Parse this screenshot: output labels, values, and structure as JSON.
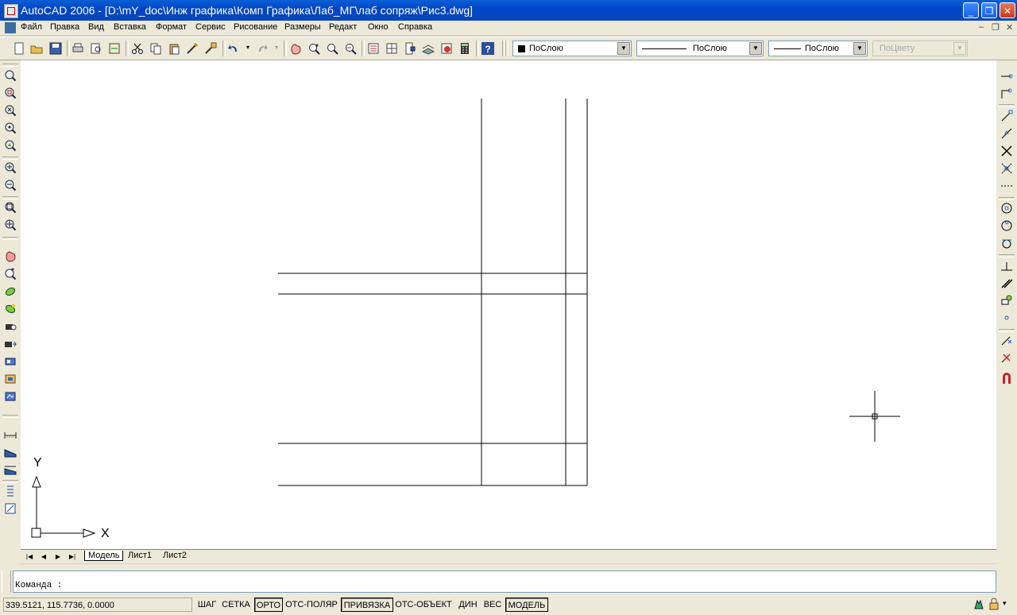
{
  "window": {
    "title": "AutoCAD 2006 - [D:\\mY_doc\\Инж графика\\Комп Графика\\Лаб_МГ\\лаб сопряж\\Рис3.dwg]"
  },
  "menu": {
    "items": [
      "Файл",
      "Правка",
      "Вид",
      "Вставка",
      "Формат",
      "Сервис",
      "Рисование",
      "Размеры",
      "Редакт",
      "Окно",
      "Справка"
    ]
  },
  "properties": {
    "color": "ПоСлою",
    "linetype": "ПоСлою",
    "lineweight": "ПоСлою",
    "plotstyle": "ПоЦвету"
  },
  "ucs": {
    "y_label": "Y",
    "x_label": "X"
  },
  "tabs": [
    "Модель",
    "Лист1",
    "Лист2"
  ],
  "active_tab": "Модель",
  "command": {
    "prompt": "Команда :"
  },
  "status": {
    "coords": "339.5121, 115.7736, 0.0000",
    "buttons": [
      "ШАГ",
      "СЕТКА",
      "ОРТО",
      "ОТС-ПОЛЯР",
      "ПРИВЯЗКА",
      "ОТС-ОБЪЕКТ",
      "ДИН",
      "ВЕС",
      "МОДЕЛЬ"
    ],
    "on": [
      false,
      false,
      true,
      false,
      true,
      false,
      false,
      false,
      true
    ]
  },
  "colors": {
    "titlebar": "#0046c8",
    "panel": "#ece9d8",
    "canvas": "#ffffff"
  }
}
